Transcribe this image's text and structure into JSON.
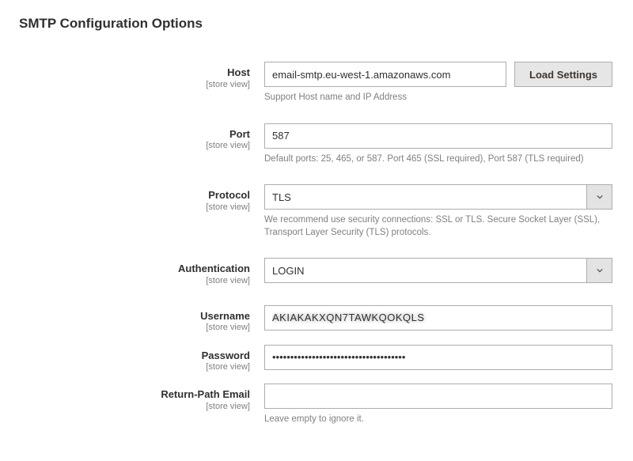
{
  "section_title": "SMTP Configuration Options",
  "scope_label": "[store view]",
  "load_settings_label": "Load Settings",
  "fields": {
    "host": {
      "label": "Host",
      "value": "email-smtp.eu-west-1.amazonaws.com",
      "help": "Support Host name and IP Address"
    },
    "port": {
      "label": "Port",
      "value": "587",
      "help": "Default ports: 25, 465, or 587. Port 465 (SSL required), Port 587 (TLS required)"
    },
    "protocol": {
      "label": "Protocol",
      "value": "TLS",
      "help": "We recommend use security connections: SSL or TLS. Secure Socket Layer (SSL), Transport Layer Security (TLS) protocols."
    },
    "authentication": {
      "label": "Authentication",
      "value": "LOGIN"
    },
    "username": {
      "label": "Username",
      "value": "AKIAKAKXQN7TAWKQOKQLS"
    },
    "password": {
      "label": "Password",
      "value": "•••••••••••••••••••••••••••••••••••••"
    },
    "return_path": {
      "label": "Return-Path Email",
      "value": "",
      "help": "Leave empty to ignore it."
    }
  }
}
